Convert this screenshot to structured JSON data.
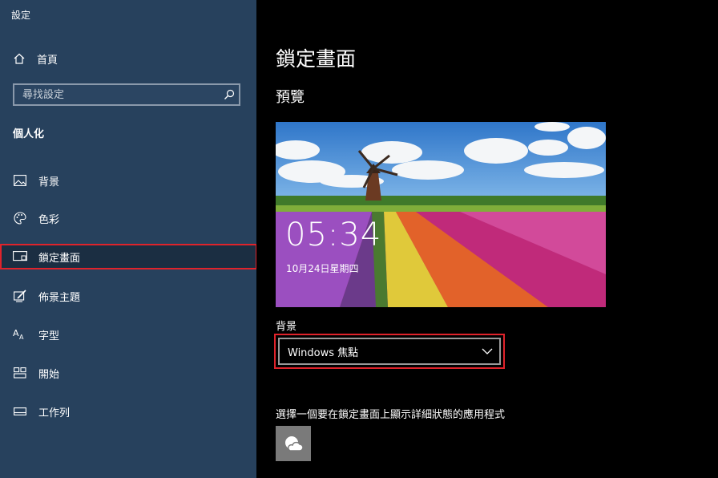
{
  "app": {
    "title": "設定"
  },
  "sidebar": {
    "home_label": "首頁",
    "search_placeholder": "尋找設定",
    "section_title": "個人化",
    "items": [
      {
        "label": "背景",
        "icon": "picture-icon"
      },
      {
        "label": "色彩",
        "icon": "palette-icon"
      },
      {
        "label": "鎖定畫面",
        "icon": "lock-screen-icon",
        "selected": true
      },
      {
        "label": "佈景主題",
        "icon": "themes-icon"
      },
      {
        "label": "字型",
        "icon": "font-icon"
      },
      {
        "label": "開始",
        "icon": "start-icon"
      },
      {
        "label": "工作列",
        "icon": "taskbar-icon"
      }
    ]
  },
  "main": {
    "title": "鎖定畫面",
    "preview_heading": "預覽",
    "preview": {
      "time": "05:34",
      "date": "10月24日星期四"
    },
    "background_label": "背景",
    "background_value": "Windows 焦點",
    "choose_app_label": "選擇一個要在鎖定畫面上顯示詳細狀態的應用程式",
    "app_icon": "weather-icon"
  },
  "colors": {
    "sidebar_bg": "#27415d",
    "main_bg": "#000000",
    "highlight": "#e0232b"
  }
}
